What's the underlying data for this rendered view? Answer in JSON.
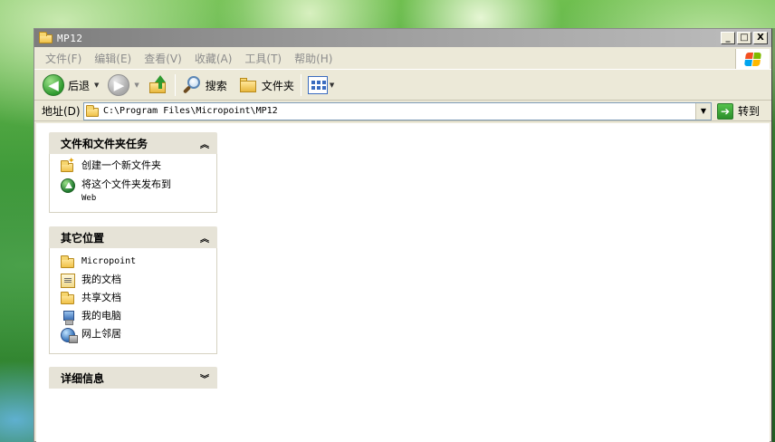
{
  "window": {
    "title": "MP12",
    "controls": {
      "minimize": "_",
      "maximize": "□",
      "close": "X"
    }
  },
  "menubar": {
    "items": [
      {
        "label": "文件(F)"
      },
      {
        "label": "编辑(E)"
      },
      {
        "label": "查看(V)"
      },
      {
        "label": "收藏(A)"
      },
      {
        "label": "工具(T)"
      },
      {
        "label": "帮助(H)"
      }
    ]
  },
  "toolbar": {
    "back_label": "后退",
    "search_label": "搜索",
    "folders_label": "文件夹"
  },
  "address": {
    "label": "地址(D)",
    "value": "C:\\Program Files\\Micropoint\\MP12",
    "go_label": "转到"
  },
  "panels": {
    "tasks": {
      "title": "文件和文件夹任务",
      "toggle": "⌃",
      "items": [
        {
          "label": "创建一个新文件夹",
          "icon": "new-folder-icon"
        },
        {
          "label": "将这个文件夹发布到",
          "label2": "Web",
          "icon": "publish-web-icon"
        }
      ]
    },
    "places": {
      "title": "其它位置",
      "toggle": "⌃",
      "items": [
        {
          "label": "Micropoint",
          "icon": "folder-icon"
        },
        {
          "label": "我的文档",
          "icon": "my-documents-icon"
        },
        {
          "label": "共享文档",
          "icon": "shared-folder-icon"
        },
        {
          "label": "我的电脑",
          "icon": "my-computer-icon"
        },
        {
          "label": "网上邻居",
          "icon": "network-places-icon"
        }
      ]
    },
    "details": {
      "title": "详细信息",
      "toggle": "⌄"
    }
  },
  "colors": {
    "titlebar_inactive": "#9a9a9a",
    "window_face": "#ece9d8",
    "menu_disabled_text": "#8c8c8c",
    "panel_header": "#e6e3d7"
  }
}
